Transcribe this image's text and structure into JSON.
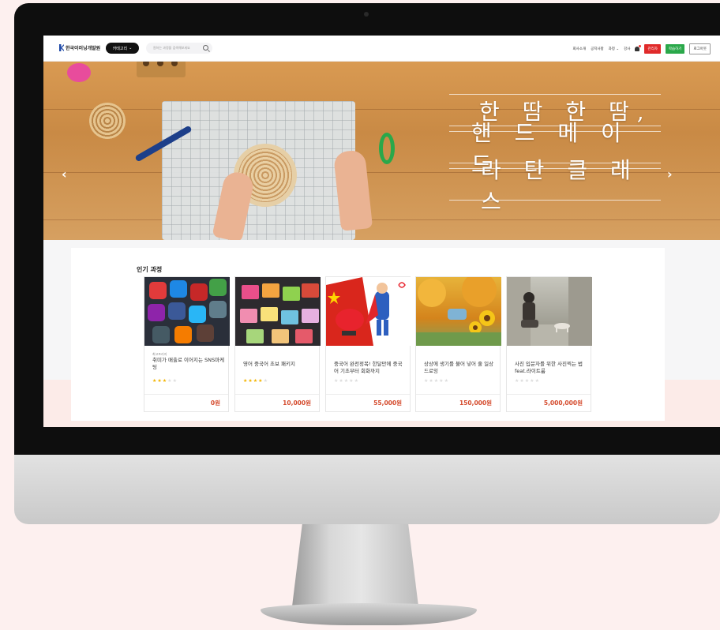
{
  "header": {
    "logo_text": "한국이러닝개발원",
    "category_button": "카테고리",
    "search_placeholder": "원하는 과정을 검색해보세요",
    "nav": [
      "회사소개",
      "공지사항",
      "과정",
      "강사"
    ],
    "buttons": {
      "admin": "관리자",
      "learn": "학습하기",
      "logout": "로그아웃"
    }
  },
  "hero": {
    "lines": [
      "한 땀 한 땀,",
      "핸 드 메 이 드",
      "라 탄 클 래 스"
    ]
  },
  "section": {
    "title": "인기 과정"
  },
  "courses": [
    {
      "category": "최고프리지",
      "title": "취미가 매출로 이어지는 SNS마케팅",
      "rating": 3,
      "price": "0원"
    },
    {
      "category": "",
      "title": "영어 중국어 초보 패키지",
      "rating": 4,
      "price": "10,000원"
    },
    {
      "category": "",
      "title": "중국어 완전정복! 한달만에 중국어 기초부터 회화까지",
      "rating": 0,
      "price": "55,000원"
    },
    {
      "category": "",
      "title": "상상에 생기를 불어 넣어 줄 일상 드로잉",
      "rating": 0,
      "price": "150,000원"
    },
    {
      "category": "",
      "title": "사진 입문자를 위한 사진찍는 법 feat.라이트룸",
      "rating": 0,
      "price": "5,000,000원"
    }
  ],
  "colors": {
    "accent_red": "#e02a2a",
    "accent_green": "#2aa84a",
    "price": "#d44a2c",
    "star": "#f3b400"
  }
}
